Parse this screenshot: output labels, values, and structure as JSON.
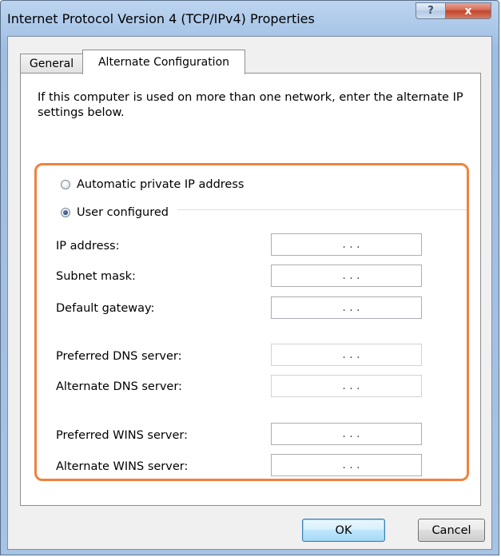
{
  "window": {
    "title": "Internet Protocol Version 4 (TCP/IPv4) Properties",
    "help_label": "?",
    "close_label": "x"
  },
  "tabs": [
    {
      "label": "General",
      "selected": false
    },
    {
      "label": "Alternate Configuration",
      "selected": true
    }
  ],
  "description": "If this computer is used on more than one network, enter the alternate IP settings below.",
  "options": {
    "automatic": {
      "label": "Automatic private IP address",
      "checked": false
    },
    "user": {
      "label": "User configured",
      "checked": true
    }
  },
  "fields": [
    {
      "label": "IP address:",
      "value": ".  .  ."
    },
    {
      "label": "Subnet mask:",
      "value": ".  .  ."
    },
    {
      "label": "Default gateway:",
      "value": ".  .  ."
    },
    {
      "label": "Preferred DNS server:",
      "value": ".  .  ."
    },
    {
      "label": "Alternate DNS server:",
      "value": ".  .  ."
    },
    {
      "label": "Preferred WINS server:",
      "value": ".  .  ."
    },
    {
      "label": "Alternate WINS server:",
      "value": ".  .  ."
    }
  ],
  "buttons": {
    "ok": "OK",
    "cancel": "Cancel"
  },
  "colors": {
    "highlight": "#f0823d",
    "title_bar": "#a9c6e8"
  }
}
